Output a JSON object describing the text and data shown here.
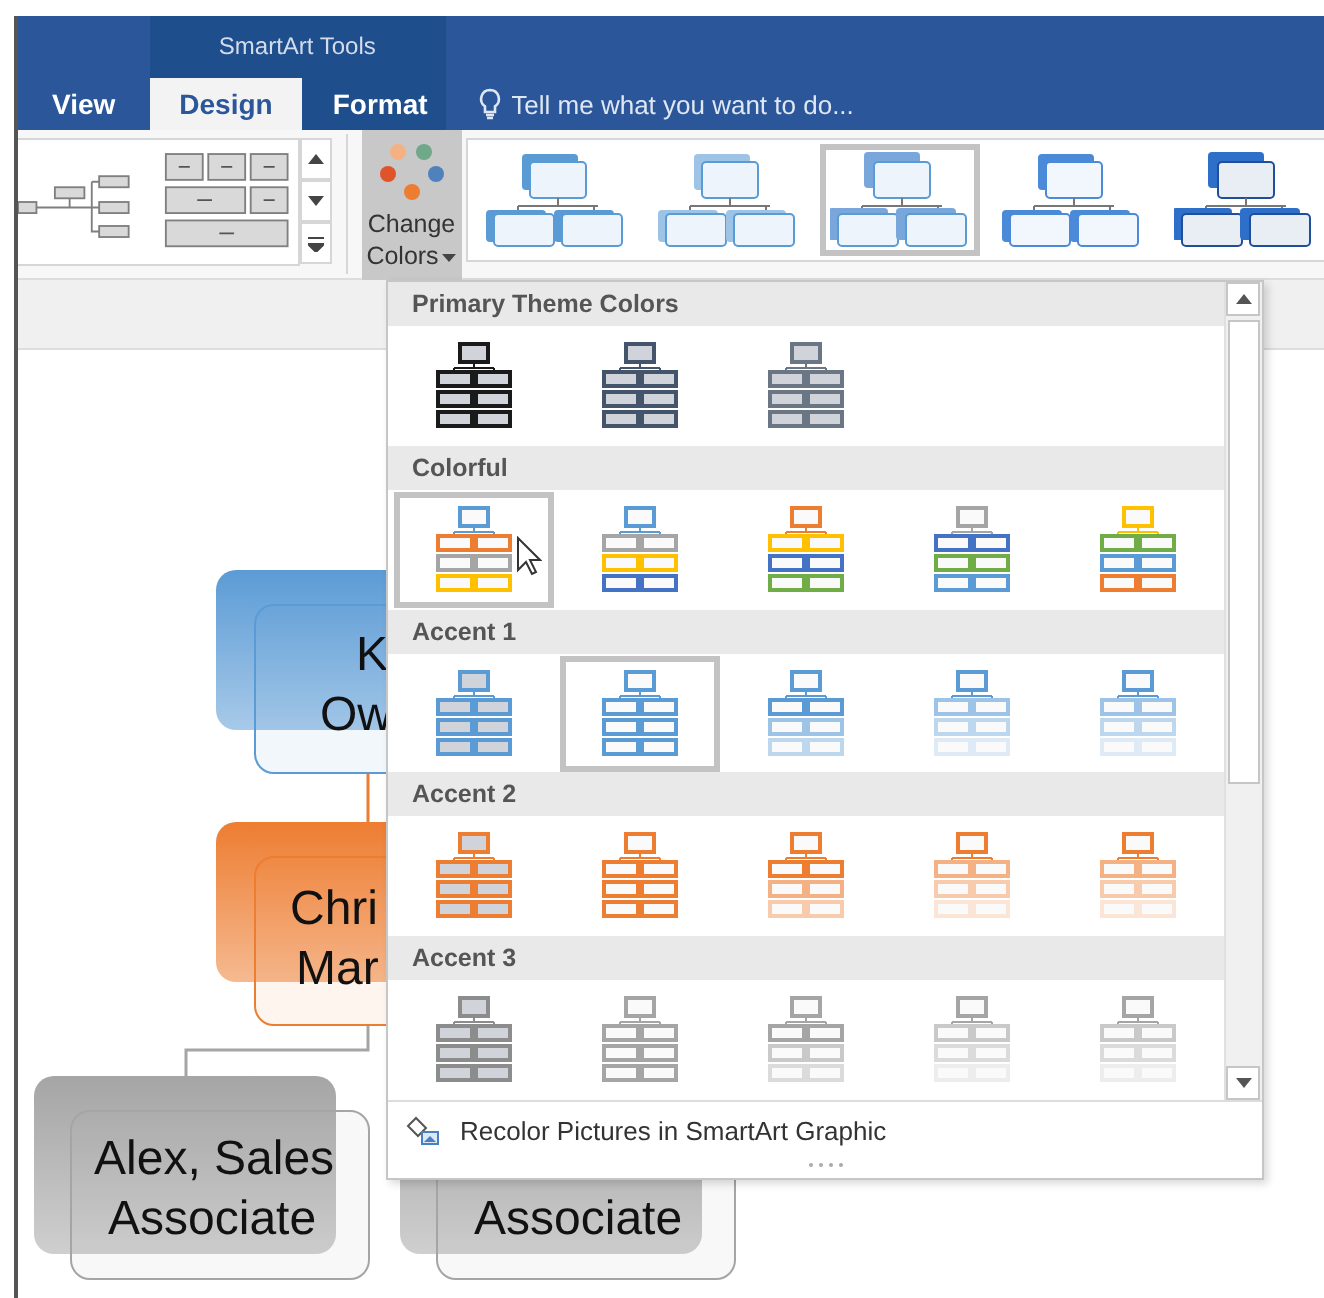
{
  "ribbon_tabs": [
    {
      "label": "View",
      "selected": false
    }
  ],
  "contextual_group": {
    "title": "SmartArt Tools",
    "tabs": [
      {
        "label": "Design",
        "selected": true
      },
      {
        "label": "Format",
        "selected": false
      }
    ]
  },
  "tell_me": {
    "placeholder": "Tell me what you want to do..."
  },
  "layout_gallery": [
    {
      "kind": "tree"
    },
    {
      "kind": "grid"
    }
  ],
  "change_colors": {
    "label": "Change Colors",
    "open": true
  },
  "style_gallery": [
    {
      "kind": "outline",
      "selected": false
    },
    {
      "kind": "subtle",
      "selected": false
    },
    {
      "kind": "stacked",
      "selected": true
    },
    {
      "kind": "bright",
      "selected": false
    },
    {
      "kind": "dark",
      "selected": false
    }
  ],
  "org_chart": {
    "nodes": [
      {
        "lines": [
          "K",
          "Ow"
        ],
        "color": "#5b9bd5"
      },
      {
        "lines": [
          "Chri",
          "Mar"
        ],
        "color": "#ed7d31"
      },
      {
        "lines": [
          "Alex, Sales",
          "Associate"
        ],
        "color": "#a5a5a5"
      },
      {
        "lines": [
          "Associate"
        ],
        "color": "#a5a5a5"
      }
    ]
  },
  "color_menu": {
    "sections": [
      {
        "title": "Primary Theme Colors",
        "options": [
          {
            "tiers": [
              {
                "color": "#1a1a1a"
              },
              {
                "color": "#1a1a1a"
              },
              {
                "color": "#1a1a1a"
              },
              {
                "color": "#1a1a1a"
              }
            ],
            "filled": true,
            "selected": false
          },
          {
            "tiers": [
              {
                "color": "#44546a"
              },
              {
                "color": "#44546a"
              },
              {
                "color": "#44546a"
              },
              {
                "color": "#44546a"
              }
            ],
            "filled": true,
            "selected": false
          },
          {
            "tiers": [
              {
                "color": "#6b7685"
              },
              {
                "color": "#6b7685"
              },
              {
                "color": "#6b7685"
              },
              {
                "color": "#6b7685"
              }
            ],
            "filled": true,
            "selected": false
          }
        ]
      },
      {
        "title": "Colorful",
        "options": [
          {
            "tiers": [
              {
                "color": "#5b9bd5"
              },
              {
                "color": "#ed7d31"
              },
              {
                "color": "#a5a5a5"
              },
              {
                "color": "#ffc000"
              }
            ],
            "filled": false,
            "selected": true
          },
          {
            "tiers": [
              {
                "color": "#5b9bd5"
              },
              {
                "color": "#a5a5a5"
              },
              {
                "color": "#ffc000"
              },
              {
                "color": "#4472c4"
              }
            ],
            "filled": false,
            "selected": false
          },
          {
            "tiers": [
              {
                "color": "#ed7d31"
              },
              {
                "color": "#ffc000"
              },
              {
                "color": "#4472c4"
              },
              {
                "color": "#70ad47"
              }
            ],
            "filled": false,
            "selected": false
          },
          {
            "tiers": [
              {
                "color": "#a5a5a5"
              },
              {
                "color": "#4472c4"
              },
              {
                "color": "#70ad47"
              },
              {
                "color": "#5b9bd5"
              }
            ],
            "filled": false,
            "selected": false
          },
          {
            "tiers": [
              {
                "color": "#ffc000"
              },
              {
                "color": "#70ad47"
              },
              {
                "color": "#5b9bd5"
              },
              {
                "color": "#ed7d31"
              }
            ],
            "filled": false,
            "selected": false
          }
        ]
      },
      {
        "title": "Accent 1",
        "options": [
          {
            "tiers": [
              {
                "color": "#5b9bd5"
              },
              {
                "color": "#5b9bd5"
              },
              {
                "color": "#5b9bd5"
              },
              {
                "color": "#5b9bd5"
              }
            ],
            "filled": true,
            "selected": false
          },
          {
            "tiers": [
              {
                "color": "#5b9bd5"
              },
              {
                "color": "#5b9bd5"
              },
              {
                "color": "#5b9bd5"
              },
              {
                "color": "#5b9bd5"
              }
            ],
            "filled": false,
            "selected": true
          },
          {
            "tiers": [
              {
                "color": "#5b9bd5"
              },
              {
                "color": "#5b9bd5"
              },
              {
                "color": "#9dc3e6"
              },
              {
                "color": "#bdd7ee"
              }
            ],
            "filled": false,
            "selected": false
          },
          {
            "tiers": [
              {
                "color": "#5b9bd5"
              },
              {
                "color": "#9dc3e6"
              },
              {
                "color": "#bdd7ee"
              },
              {
                "color": "#deebf7"
              }
            ],
            "filled": false,
            "selected": false
          },
          {
            "tiers": [
              {
                "color": "#5b9bd5"
              },
              {
                "color": "#9dc3e6"
              },
              {
                "color": "#bdd7ee"
              },
              {
                "color": "#deebf7"
              }
            ],
            "filled": false,
            "selected": false
          }
        ]
      },
      {
        "title": "Accent 2",
        "options": [
          {
            "tiers": [
              {
                "color": "#ed7d31"
              },
              {
                "color": "#ed7d31"
              },
              {
                "color": "#ed7d31"
              },
              {
                "color": "#ed7d31"
              }
            ],
            "filled": true,
            "selected": false
          },
          {
            "tiers": [
              {
                "color": "#ed7d31"
              },
              {
                "color": "#ed7d31"
              },
              {
                "color": "#ed7d31"
              },
              {
                "color": "#ed7d31"
              }
            ],
            "filled": false,
            "selected": false
          },
          {
            "tiers": [
              {
                "color": "#ed7d31"
              },
              {
                "color": "#ed7d31"
              },
              {
                "color": "#f4b183"
              },
              {
                "color": "#f8cbad"
              }
            ],
            "filled": false,
            "selected": false
          },
          {
            "tiers": [
              {
                "color": "#ed7d31"
              },
              {
                "color": "#f4b183"
              },
              {
                "color": "#f8cbad"
              },
              {
                "color": "#fbe5d6"
              }
            ],
            "filled": false,
            "selected": false
          },
          {
            "tiers": [
              {
                "color": "#ed7d31"
              },
              {
                "color": "#f4b183"
              },
              {
                "color": "#f8cbad"
              },
              {
                "color": "#fbe5d6"
              }
            ],
            "filled": false,
            "selected": false
          }
        ]
      },
      {
        "title": "Accent 3",
        "options": [
          {
            "tiers": [
              {
                "color": "#8c8c8c"
              },
              {
                "color": "#8c8c8c"
              },
              {
                "color": "#8c8c8c"
              },
              {
                "color": "#8c8c8c"
              }
            ],
            "filled": true,
            "selected": false
          },
          {
            "tiers": [
              {
                "color": "#a5a5a5"
              },
              {
                "color": "#a5a5a5"
              },
              {
                "color": "#a5a5a5"
              },
              {
                "color": "#a5a5a5"
              }
            ],
            "filled": false,
            "selected": false
          },
          {
            "tiers": [
              {
                "color": "#a5a5a5"
              },
              {
                "color": "#a5a5a5"
              },
              {
                "color": "#c9c9c9"
              },
              {
                "color": "#dbdbdb"
              }
            ],
            "filled": false,
            "selected": false
          },
          {
            "tiers": [
              {
                "color": "#a5a5a5"
              },
              {
                "color": "#c9c9c9"
              },
              {
                "color": "#dbdbdb"
              },
              {
                "color": "#ededed"
              }
            ],
            "filled": false,
            "selected": false
          },
          {
            "tiers": [
              {
                "color": "#a5a5a5"
              },
              {
                "color": "#c9c9c9"
              },
              {
                "color": "#dbdbdb"
              },
              {
                "color": "#ededed"
              }
            ],
            "filled": false,
            "selected": false
          }
        ]
      }
    ],
    "footer": "Recolor Pictures in SmartArt Graphic"
  }
}
